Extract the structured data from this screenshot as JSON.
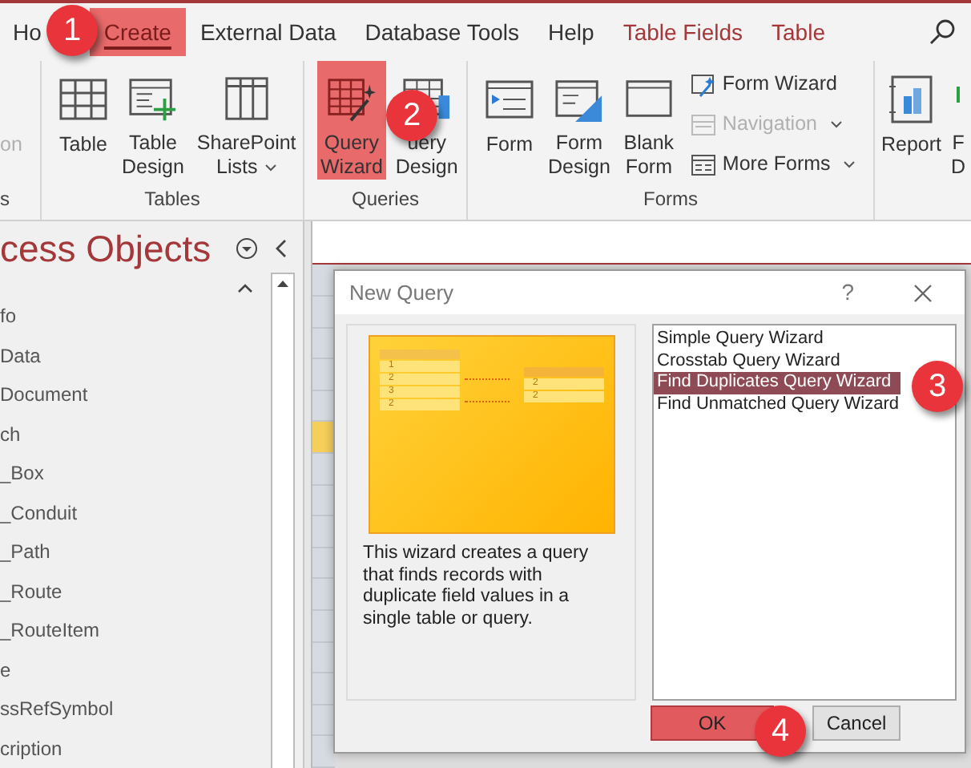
{
  "tabs": [
    {
      "label": "Ho",
      "selected": false,
      "kind": "normal"
    },
    {
      "label": "Create",
      "selected": true,
      "kind": "normal"
    },
    {
      "label": "External Data",
      "selected": false,
      "kind": "normal"
    },
    {
      "label": "Database Tools",
      "selected": false,
      "kind": "normal"
    },
    {
      "label": "Help",
      "selected": false,
      "kind": "normal"
    },
    {
      "label": "Table Fields",
      "selected": false,
      "kind": "context"
    },
    {
      "label": "Table",
      "selected": false,
      "kind": "context"
    }
  ],
  "ribbon_groups": [
    {
      "label": "s",
      "items": [
        {
          "kind": "large",
          "lines": [
            "on"
          ],
          "disabled": true,
          "selected": false,
          "dropdown": false
        }
      ]
    },
    {
      "label": "Tables",
      "items": [
        {
          "kind": "large",
          "lines": [
            "Table"
          ],
          "disabled": false,
          "selected": false,
          "dropdown": false
        },
        {
          "kind": "large",
          "lines": [
            "Table",
            "Design"
          ],
          "disabled": false,
          "selected": false,
          "dropdown": false
        },
        {
          "kind": "large",
          "lines": [
            "SharePoint",
            "Lists"
          ],
          "disabled": false,
          "selected": false,
          "dropdown": true
        }
      ]
    },
    {
      "label": "Queries",
      "items": [
        {
          "kind": "large",
          "lines": [
            "Query",
            "Wizard"
          ],
          "disabled": false,
          "selected": true,
          "dropdown": false
        },
        {
          "kind": "large",
          "lines": [
            "uery",
            "Design"
          ],
          "disabled": false,
          "selected": false,
          "dropdown": false
        }
      ]
    },
    {
      "label": "Forms",
      "items": [
        {
          "kind": "large",
          "lines": [
            "Form"
          ],
          "disabled": false,
          "selected": false,
          "dropdown": false
        },
        {
          "kind": "large",
          "lines": [
            "Form",
            "Design"
          ],
          "disabled": false,
          "selected": false,
          "dropdown": false
        },
        {
          "kind": "large",
          "lines": [
            "Blank",
            "Form"
          ],
          "disabled": false,
          "selected": false,
          "dropdown": false
        },
        {
          "kind": "small",
          "lines": [
            "Form Wizard"
          ],
          "disabled": false,
          "selected": false,
          "dropdown": false
        },
        {
          "kind": "small",
          "lines": [
            "Navigation"
          ],
          "disabled": true,
          "selected": false,
          "dropdown": true
        },
        {
          "kind": "small",
          "lines": [
            "More Forms"
          ],
          "disabled": false,
          "selected": false,
          "dropdown": true
        }
      ]
    },
    {
      "items": [
        {
          "kind": "large",
          "lines": [
            "Report"
          ],
          "disabled": false,
          "selected": false,
          "dropdown": false
        },
        {
          "kind": "large",
          "lines": [
            "F",
            "D"
          ],
          "disabled": false,
          "selected": false,
          "dropdown": false
        }
      ]
    }
  ],
  "nav_pane": {
    "title": "cess Objects",
    "items": [
      "fo",
      "Data",
      "Document",
      "ch",
      "_Box",
      "_Conduit",
      "_Path",
      "_Route",
      "_RouteItem",
      "e",
      "ssRefSymbol",
      "cription"
    ]
  },
  "dialog": {
    "title": "New Query",
    "help": "?",
    "wizard_image": {
      "left_rows": [
        "1",
        "2",
        "3",
        "2"
      ],
      "right_rows": [
        "2",
        "2"
      ]
    },
    "description": "This wizard creates a query that finds records with duplicate field values in a single table or query.",
    "options": [
      {
        "label": "Simple Query Wizard",
        "selected": false
      },
      {
        "label": "Crosstab Query Wizard",
        "selected": false
      },
      {
        "label": "Find Duplicates Query Wizard",
        "selected": true
      },
      {
        "label": "Find Unmatched Query Wizard",
        "selected": false
      }
    ],
    "buttons": [
      {
        "label": "OK",
        "selected": true
      },
      {
        "label": "Cancel",
        "selected": false
      }
    ]
  },
  "callouts": [
    "1",
    "2",
    "3",
    "4"
  ]
}
